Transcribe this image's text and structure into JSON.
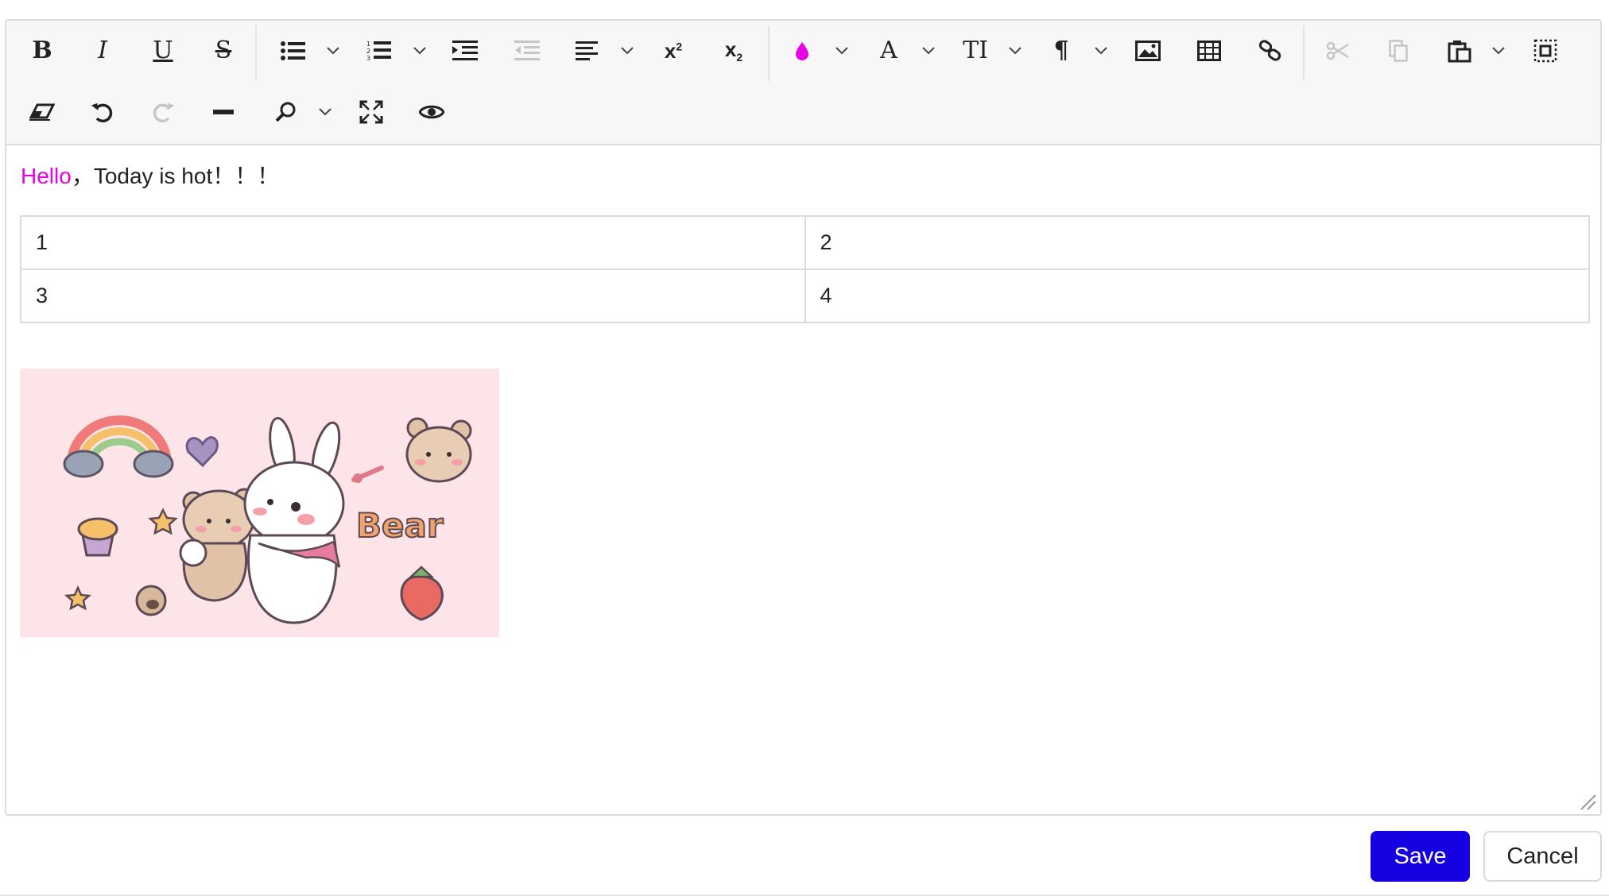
{
  "toolbar": {
    "row1": [
      {
        "name": "bold-button",
        "icon": "bold-icon",
        "glyph": "B",
        "enabled": true
      },
      {
        "name": "italic-button",
        "icon": "italic-icon",
        "glyph": "I",
        "enabled": true
      },
      {
        "name": "underline-button",
        "icon": "underline-icon",
        "glyph": "U",
        "enabled": true
      },
      {
        "name": "strikethrough-button",
        "icon": "strikethrough-icon",
        "glyph": "S",
        "enabled": true
      },
      {
        "name": "bullet-list-button",
        "icon": "bullet-list-icon",
        "enabled": true
      },
      {
        "name": "numbered-list-button",
        "icon": "numbered-list-icon",
        "enabled": true
      },
      {
        "name": "indent-button",
        "icon": "indent-icon",
        "enabled": true
      },
      {
        "name": "outdent-button",
        "icon": "outdent-icon",
        "enabled": false
      },
      {
        "name": "align-button",
        "icon": "align-left-icon",
        "enabled": true
      },
      {
        "name": "superscript-button",
        "icon": "superscript-icon",
        "enabled": true
      },
      {
        "name": "subscript-button",
        "icon": "subscript-icon",
        "enabled": true
      },
      {
        "name": "font-color-button",
        "icon": "droplet-icon",
        "enabled": true
      },
      {
        "name": "font-family-button",
        "icon": "font-icon",
        "glyph": "A",
        "enabled": true
      },
      {
        "name": "font-size-button",
        "icon": "text-size-icon",
        "glyph": "TI",
        "enabled": true
      },
      {
        "name": "paragraph-button",
        "icon": "paragraph-icon",
        "glyph": "¶",
        "enabled": true
      },
      {
        "name": "insert-image-button",
        "icon": "image-icon",
        "enabled": true
      },
      {
        "name": "insert-table-button",
        "icon": "table-icon",
        "enabled": true
      },
      {
        "name": "insert-link-button",
        "icon": "link-icon",
        "enabled": true
      },
      {
        "name": "cut-button",
        "icon": "scissors-icon",
        "enabled": false
      },
      {
        "name": "copy-button",
        "icon": "copy-icon",
        "enabled": false
      },
      {
        "name": "paste-button",
        "icon": "clipboard-icon",
        "enabled": true
      },
      {
        "name": "select-all-button",
        "icon": "select-all-icon",
        "enabled": true
      }
    ],
    "row2": [
      {
        "name": "clear-format-button",
        "icon": "eraser-icon",
        "enabled": true
      },
      {
        "name": "undo-button",
        "icon": "undo-icon",
        "enabled": true
      },
      {
        "name": "redo-button",
        "icon": "redo-icon",
        "enabled": false
      },
      {
        "name": "horizontal-rule-button",
        "icon": "horizontal-rule-icon",
        "enabled": true
      },
      {
        "name": "find-button",
        "icon": "search-icon",
        "enabled": true
      },
      {
        "name": "fullscreen-button",
        "icon": "fullscreen-icon",
        "enabled": true
      },
      {
        "name": "preview-button",
        "icon": "eye-icon",
        "enabled": true
      }
    ]
  },
  "colors": {
    "accent_text": "#e600e6",
    "save_button": "#1400e0",
    "disabled_icon": "#c6c6c6"
  },
  "content": {
    "paragraph": {
      "highlight": "Hello",
      "rest": "，Today is hot！！！"
    },
    "table": [
      [
        "1",
        "2"
      ],
      [
        "3",
        "4"
      ]
    ],
    "image_text": "Bear"
  },
  "actions": {
    "save_label": "Save",
    "cancel_label": "Cancel"
  }
}
